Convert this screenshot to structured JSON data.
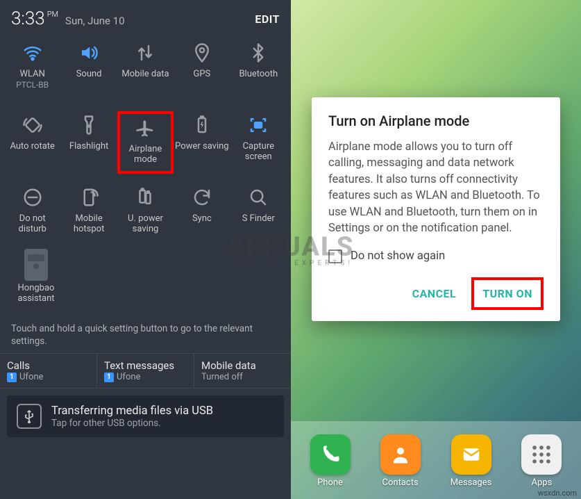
{
  "left": {
    "time": "3:33",
    "ampm": "PM",
    "date": "Sun, June 10",
    "edit": "EDIT",
    "tiles": [
      {
        "icon": "wifi",
        "label": "WLAN",
        "sub": "PTCL-BB",
        "active": true
      },
      {
        "icon": "sound",
        "label": "Sound",
        "sub": "",
        "active": true
      },
      {
        "icon": "mobiledata",
        "label": "Mobile data",
        "sub": "",
        "active": false
      },
      {
        "icon": "gps",
        "label": "GPS",
        "sub": "",
        "active": false
      },
      {
        "icon": "bluetooth",
        "label": "Bluetooth",
        "sub": "",
        "active": false
      },
      {
        "icon": "rotate",
        "label": "Auto rotate",
        "sub": "",
        "active": false
      },
      {
        "icon": "flashlight",
        "label": "Flashlight",
        "sub": "",
        "active": false
      },
      {
        "icon": "airplane",
        "label": "Airplane mode",
        "sub": "",
        "active": false,
        "highlight": true
      },
      {
        "icon": "powersave",
        "label": "Power saving",
        "sub": "",
        "active": false
      },
      {
        "icon": "capture",
        "label": "Capture screen",
        "sub": "",
        "active": false
      },
      {
        "icon": "dnd",
        "label": "Do not disturb",
        "sub": "",
        "active": false
      },
      {
        "icon": "hotspot",
        "label": "Mobile hotspot",
        "sub": "",
        "active": false
      },
      {
        "icon": "upowersave",
        "label": "U. power saving",
        "sub": "",
        "active": false
      },
      {
        "icon": "sync",
        "label": "Sync",
        "sub": "",
        "active": false
      },
      {
        "icon": "sfinder",
        "label": "S Finder",
        "sub": "",
        "active": false
      }
    ],
    "hongbao": "Hongbao assistant",
    "hint": "Touch and hold a quick setting button to go to the relevant settings.",
    "sims": [
      {
        "title": "Calls",
        "badge": "1",
        "carrier": "Ufone"
      },
      {
        "title": "Text messages",
        "badge": "1",
        "carrier": "Ufone"
      },
      {
        "title": "Mobile data",
        "badge": "",
        "carrier": "Turned off"
      }
    ],
    "usb": {
      "title": "Transferring media files via USB",
      "sub": "Tap for other USB options."
    }
  },
  "right": {
    "dialog": {
      "title": "Turn on Airplane mode",
      "body": "Airplane mode allows you to turn off calling, messaging and data network features. It also turns off connectivity features such as WLAN and Bluetooth. To use WLAN and Bluetooth, turn them on in Settings or on the notification panel.",
      "checkbox": "Do not show again",
      "cancel": "CANCEL",
      "confirm": "TURN ON"
    },
    "dock": [
      {
        "name": "Phone",
        "color": "#2fb24f",
        "icon": "phone"
      },
      {
        "name": "Contacts",
        "color": "#ff8a1e",
        "icon": "contacts"
      },
      {
        "name": "Messages",
        "color": "#f5b400",
        "icon": "messages"
      },
      {
        "name": "Apps",
        "color": "#f0f0f0",
        "icon": "apps",
        "fg": "#6e6e6e"
      }
    ]
  },
  "watermark": {
    "main": "APPUALS",
    "sub": "FROM  THE  EXPERTS!",
    "corner": "wsxdn.com"
  }
}
